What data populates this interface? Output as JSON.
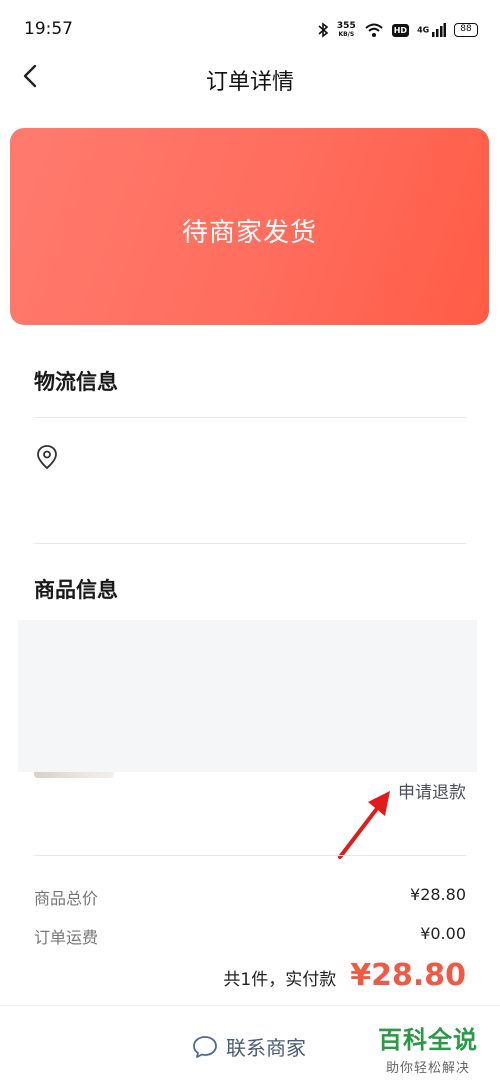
{
  "status_bar": {
    "time": "19:57",
    "net_speed": "355",
    "net_unit": "KB/S",
    "hd": "HD",
    "network": "4G",
    "battery": "88"
  },
  "nav": {
    "back_icon": "chevron-left-icon",
    "title": "订单详情"
  },
  "order_status": {
    "text": "待商家发货",
    "gradient_start": "#ff7b6e",
    "gradient_end": "#ff5c46"
  },
  "logistics": {
    "title": "物流信息",
    "icon": "location-pin-icon"
  },
  "goods": {
    "title": "商品信息",
    "refund_label": "申请退款"
  },
  "prices": {
    "items": [
      {
        "label": "商品总价",
        "value": "¥28.80"
      },
      {
        "label": "订单运费",
        "value": "¥0.00"
      }
    ],
    "total_count": "共1件，实付款",
    "total_amount": "¥28.80",
    "accent": "#f05a44"
  },
  "bottom": {
    "contact_label": "联系商家",
    "contact_icon": "chat-bubble-icon"
  },
  "watermark": {
    "title": "百科全说",
    "subtitle": "助你轻松解决"
  }
}
